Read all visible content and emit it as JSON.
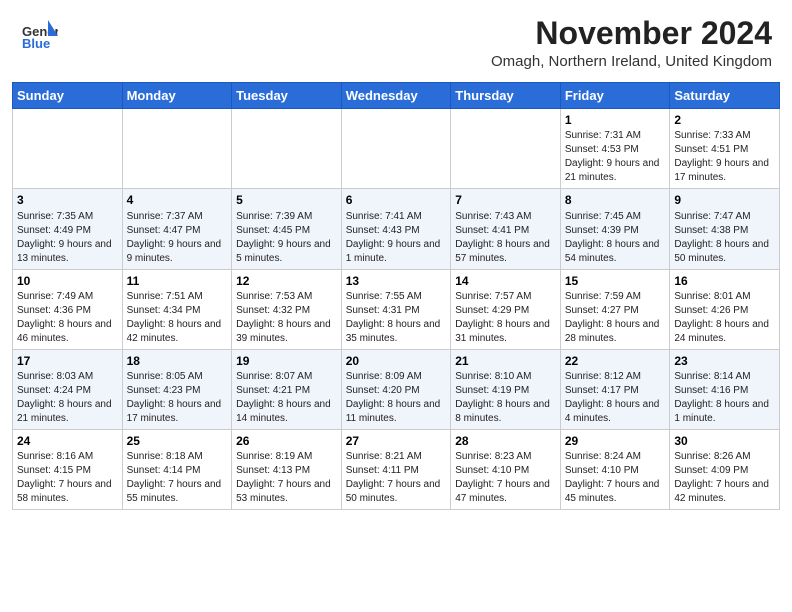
{
  "header": {
    "logo_general": "General",
    "logo_blue": "Blue",
    "month": "November 2024",
    "location": "Omagh, Northern Ireland, United Kingdom"
  },
  "weekdays": [
    "Sunday",
    "Monday",
    "Tuesday",
    "Wednesday",
    "Thursday",
    "Friday",
    "Saturday"
  ],
  "weeks": [
    [
      {
        "day": "",
        "info": ""
      },
      {
        "day": "",
        "info": ""
      },
      {
        "day": "",
        "info": ""
      },
      {
        "day": "",
        "info": ""
      },
      {
        "day": "",
        "info": ""
      },
      {
        "day": "1",
        "info": "Sunrise: 7:31 AM\nSunset: 4:53 PM\nDaylight: 9 hours and 21 minutes."
      },
      {
        "day": "2",
        "info": "Sunrise: 7:33 AM\nSunset: 4:51 PM\nDaylight: 9 hours and 17 minutes."
      }
    ],
    [
      {
        "day": "3",
        "info": "Sunrise: 7:35 AM\nSunset: 4:49 PM\nDaylight: 9 hours and 13 minutes."
      },
      {
        "day": "4",
        "info": "Sunrise: 7:37 AM\nSunset: 4:47 PM\nDaylight: 9 hours and 9 minutes."
      },
      {
        "day": "5",
        "info": "Sunrise: 7:39 AM\nSunset: 4:45 PM\nDaylight: 9 hours and 5 minutes."
      },
      {
        "day": "6",
        "info": "Sunrise: 7:41 AM\nSunset: 4:43 PM\nDaylight: 9 hours and 1 minute."
      },
      {
        "day": "7",
        "info": "Sunrise: 7:43 AM\nSunset: 4:41 PM\nDaylight: 8 hours and 57 minutes."
      },
      {
        "day": "8",
        "info": "Sunrise: 7:45 AM\nSunset: 4:39 PM\nDaylight: 8 hours and 54 minutes."
      },
      {
        "day": "9",
        "info": "Sunrise: 7:47 AM\nSunset: 4:38 PM\nDaylight: 8 hours and 50 minutes."
      }
    ],
    [
      {
        "day": "10",
        "info": "Sunrise: 7:49 AM\nSunset: 4:36 PM\nDaylight: 8 hours and 46 minutes."
      },
      {
        "day": "11",
        "info": "Sunrise: 7:51 AM\nSunset: 4:34 PM\nDaylight: 8 hours and 42 minutes."
      },
      {
        "day": "12",
        "info": "Sunrise: 7:53 AM\nSunset: 4:32 PM\nDaylight: 8 hours and 39 minutes."
      },
      {
        "day": "13",
        "info": "Sunrise: 7:55 AM\nSunset: 4:31 PM\nDaylight: 8 hours and 35 minutes."
      },
      {
        "day": "14",
        "info": "Sunrise: 7:57 AM\nSunset: 4:29 PM\nDaylight: 8 hours and 31 minutes."
      },
      {
        "day": "15",
        "info": "Sunrise: 7:59 AM\nSunset: 4:27 PM\nDaylight: 8 hours and 28 minutes."
      },
      {
        "day": "16",
        "info": "Sunrise: 8:01 AM\nSunset: 4:26 PM\nDaylight: 8 hours and 24 minutes."
      }
    ],
    [
      {
        "day": "17",
        "info": "Sunrise: 8:03 AM\nSunset: 4:24 PM\nDaylight: 8 hours and 21 minutes."
      },
      {
        "day": "18",
        "info": "Sunrise: 8:05 AM\nSunset: 4:23 PM\nDaylight: 8 hours and 17 minutes."
      },
      {
        "day": "19",
        "info": "Sunrise: 8:07 AM\nSunset: 4:21 PM\nDaylight: 8 hours and 14 minutes."
      },
      {
        "day": "20",
        "info": "Sunrise: 8:09 AM\nSunset: 4:20 PM\nDaylight: 8 hours and 11 minutes."
      },
      {
        "day": "21",
        "info": "Sunrise: 8:10 AM\nSunset: 4:19 PM\nDaylight: 8 hours and 8 minutes."
      },
      {
        "day": "22",
        "info": "Sunrise: 8:12 AM\nSunset: 4:17 PM\nDaylight: 8 hours and 4 minutes."
      },
      {
        "day": "23",
        "info": "Sunrise: 8:14 AM\nSunset: 4:16 PM\nDaylight: 8 hours and 1 minute."
      }
    ],
    [
      {
        "day": "24",
        "info": "Sunrise: 8:16 AM\nSunset: 4:15 PM\nDaylight: 7 hours and 58 minutes."
      },
      {
        "day": "25",
        "info": "Sunrise: 8:18 AM\nSunset: 4:14 PM\nDaylight: 7 hours and 55 minutes."
      },
      {
        "day": "26",
        "info": "Sunrise: 8:19 AM\nSunset: 4:13 PM\nDaylight: 7 hours and 53 minutes."
      },
      {
        "day": "27",
        "info": "Sunrise: 8:21 AM\nSunset: 4:11 PM\nDaylight: 7 hours and 50 minutes."
      },
      {
        "day": "28",
        "info": "Sunrise: 8:23 AM\nSunset: 4:10 PM\nDaylight: 7 hours and 47 minutes."
      },
      {
        "day": "29",
        "info": "Sunrise: 8:24 AM\nSunset: 4:10 PM\nDaylight: 7 hours and 45 minutes."
      },
      {
        "day": "30",
        "info": "Sunrise: 8:26 AM\nSunset: 4:09 PM\nDaylight: 7 hours and 42 minutes."
      }
    ]
  ]
}
